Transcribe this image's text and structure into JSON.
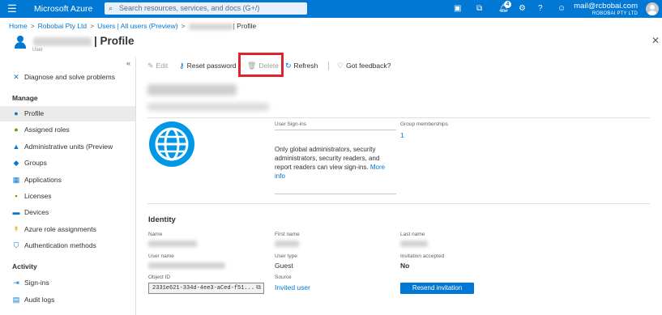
{
  "topbar": {
    "menu_icon": "hamburger-icon",
    "brand": "Microsoft Azure",
    "search_placeholder": "Search resources, services, and docs (G+/)",
    "notification_count": "4",
    "account_email": "mail@rcbobai.com",
    "account_org": "ROBOBAI PTY LTD"
  },
  "breadcrumb": {
    "items": [
      "Home",
      "Robobai Pty Ltd",
      "Users | All users (Preview)",
      "| Profile"
    ]
  },
  "header": {
    "title": "| Profile",
    "subtitle": "User"
  },
  "sidebar": {
    "collapse_glyph": "«",
    "top_item": "Diagnose and solve problems",
    "section_manage": "Manage",
    "manage_items": [
      "Profile",
      "Assigned roles",
      "Administrative units (Preview",
      "Groups",
      "Applications",
      "Licenses",
      "Devices",
      "Azure role assignments",
      "Authentication methods"
    ],
    "section_activity": "Activity",
    "activity_items": [
      "Sign-ins",
      "Audit logs"
    ]
  },
  "toolbar": {
    "edit": "Edit",
    "reset_password": "Reset password",
    "delete": "Delete",
    "refresh": "Refresh",
    "feedback": "Got feedback?"
  },
  "highlight_color": "#e0232c",
  "accent_color": "#0078d4",
  "signins": {
    "label": "User Sign-ins",
    "text": "Only global administrators, security administrators, security readers, and report readers can view sign-ins.",
    "more": "More info"
  },
  "groups": {
    "label": "Group memberships",
    "value": "1"
  },
  "identity": {
    "heading": "Identity",
    "name_label": "Name",
    "first_name_label": "First name",
    "last_name_label": "Last name",
    "user_name_label": "User name",
    "user_type_label": "User type",
    "user_type_value": "Guest",
    "invitation_label": "Invitation accepted",
    "invitation_value": "No",
    "object_id_label": "Object ID",
    "object_id_value": "2331e621-334d-4ee3-aCed-f51...",
    "source_label": "Source",
    "source_value": "Invited user",
    "resend_button": "Resend invitation"
  }
}
